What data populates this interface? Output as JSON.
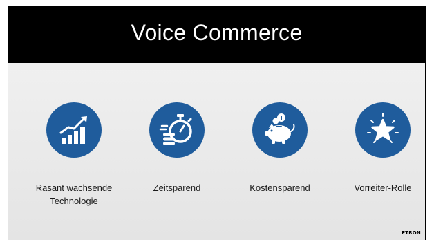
{
  "slide": {
    "title": "Voice Commerce",
    "brand": "ETRON"
  },
  "colors": {
    "header": "#000000",
    "icon_circle": "#1f5c9c",
    "icon_glyph": "#ffffff"
  },
  "features": [
    {
      "label_line1": "Rasant wachsende",
      "label_line2": "Technologie",
      "icon": "growth-chart-icon"
    },
    {
      "label_line1": "Zeitsparend",
      "label_line2": "",
      "icon": "stopwatch-coins-icon"
    },
    {
      "label_line1": "Kostensparend",
      "label_line2": "",
      "icon": "piggy-bank-icon"
    },
    {
      "label_line1": "Vorreiter-Rolle",
      "label_line2": "",
      "icon": "star-icon"
    }
  ]
}
